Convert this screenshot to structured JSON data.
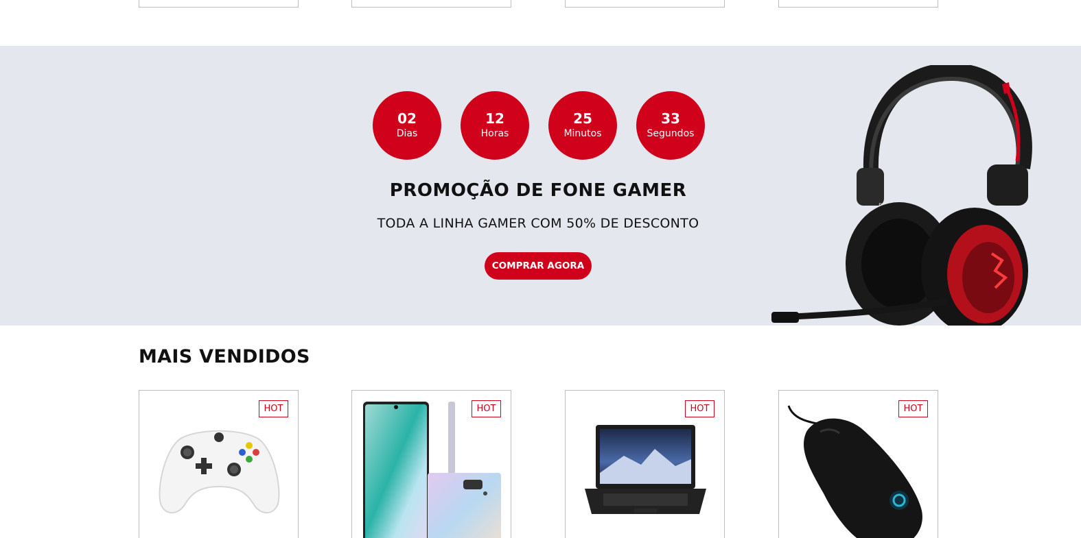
{
  "countdown": [
    {
      "value": "02",
      "label": "Dias"
    },
    {
      "value": "12",
      "label": "Horas"
    },
    {
      "value": "25",
      "label": "Minutos"
    },
    {
      "value": "33",
      "label": "Segundos"
    }
  ],
  "promo": {
    "title": "PROMOÇÃO DE FONE GAMER",
    "subtitle": "TODA A LINHA GAMER COM 50% DE DESCONTO",
    "button_label": "COMPRAR AGORA",
    "image_icon": "gaming-headset-image"
  },
  "best_sellers": {
    "title": "MAIS VENDIDOS",
    "products": [
      {
        "badge": "HOT",
        "image_icon": "game-controller-image"
      },
      {
        "badge": "HOT",
        "image_icon": "smartphone-image"
      },
      {
        "badge": "HOT",
        "image_icon": "laptop-image"
      },
      {
        "badge": "HOT",
        "image_icon": "mouse-image"
      }
    ]
  },
  "colors": {
    "accent": "#d0021b",
    "promo_background": "#e4e7ed",
    "card_border": "#bdbdbd"
  }
}
